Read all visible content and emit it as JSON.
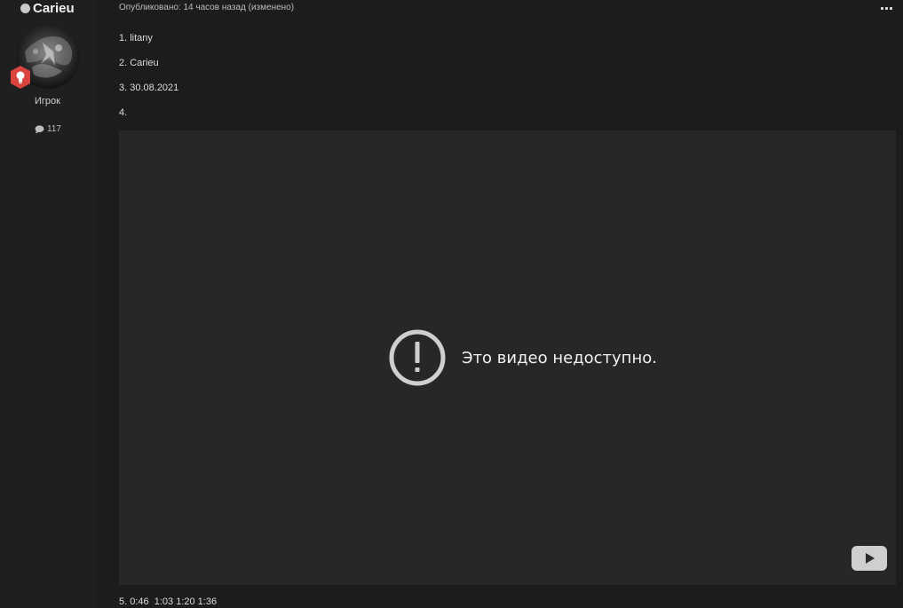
{
  "author": {
    "name": "Carieu",
    "rank": "Игрок",
    "posts_count": "117",
    "status_icon": "online-status-dot",
    "badge_icon": "lightbulb-icon",
    "badge_color": "#d9443f",
    "posts_icon": "speech-bubble-icon"
  },
  "post": {
    "published": "Опубликовано: 14 часов назад (изменено)",
    "more_icon": "ellipsis-icon",
    "lines": [
      "1. litany",
      "2. Carieu",
      "3. 30.08.2021",
      "4."
    ],
    "video": {
      "message": "Это видео недоступно.",
      "error_icon": "exclamation-circle-icon",
      "play_icon": "youtube-play-icon"
    },
    "line5": "5. 0:46  1:03 1:20 1:36"
  }
}
